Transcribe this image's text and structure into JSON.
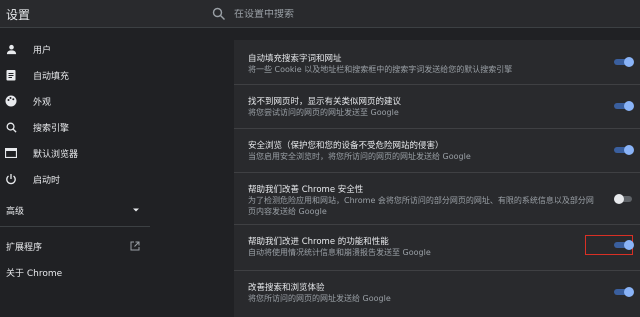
{
  "app_title": "设置",
  "search": {
    "placeholder": "在设置中搜索"
  },
  "sidebar": {
    "items": [
      {
        "label": "用户",
        "icon": "person-icon"
      },
      {
        "label": "自动填充",
        "icon": "clipboard-icon"
      },
      {
        "label": "外观",
        "icon": "palette-icon"
      },
      {
        "label": "搜索引擎",
        "icon": "search-icon"
      },
      {
        "label": "默认浏览器",
        "icon": "browser-icon"
      },
      {
        "label": "启动时",
        "icon": "power-icon"
      }
    ],
    "advanced": "高级",
    "extensions": "扩展程序",
    "about": "关于 Chrome"
  },
  "settings": [
    {
      "title": "自动填充搜索字词和网址",
      "desc": "将一些 Cookie 以及地址栏和搜索框中的搜索字词发送给您的默认搜索引擎",
      "on": true
    },
    {
      "title": "找不到网页时，显示有关类似网页的建议",
      "desc": "将您尝试访问的网页的网址发送至 Google",
      "on": true
    },
    {
      "title": "安全浏览（保护您和您的设备不受危险网站的侵害）",
      "desc": "当您启用安全浏览时，将您所访问的网页的网址发送给 Google",
      "on": true
    },
    {
      "title": "帮助我们改善 Chrome 安全性",
      "desc": "为了检测危险应用和网站，Chrome 会将您所访问的部分网页的网址、有限的系统信息以及部分网页内容发送给 Google",
      "on": false
    },
    {
      "title": "帮助我们改进 Chrome 的功能和性能",
      "desc": "自动将使用情况统计信息和崩溃报告发送至 Google",
      "on": true
    },
    {
      "title": "改善搜索和浏览体验",
      "desc": "将您所访问的网页的网址发送给 Google",
      "on": true
    }
  ],
  "colors": {
    "accent": "#8ab4f8",
    "highlight": "#d93025"
  }
}
